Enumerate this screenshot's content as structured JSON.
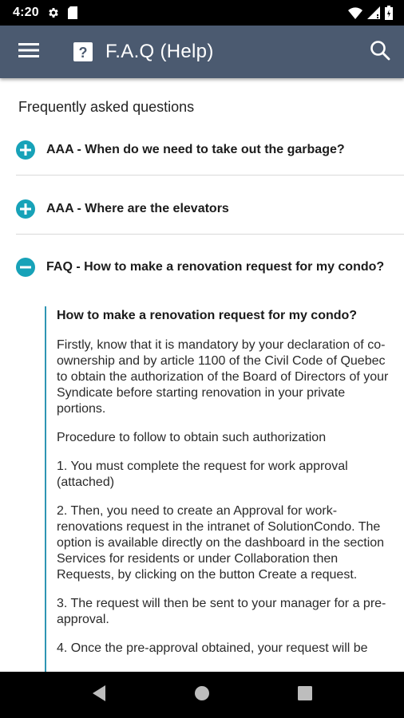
{
  "status_bar": {
    "time": "4:20"
  },
  "app_bar": {
    "title": "F.A.Q (Help)"
  },
  "faq": {
    "section_title": "Frequently asked questions",
    "items": [
      {
        "question": "AAA - When do we need to take out the garbage?",
        "expanded": false
      },
      {
        "question": "AAA - Where are the elevators",
        "expanded": false
      },
      {
        "question": "FAQ - How to make a renovation request for my condo?",
        "expanded": true
      }
    ],
    "answer": {
      "title": "How to make a renovation request for my condo?",
      "paragraphs": [
        "Firstly, know that it is mandatory by your declaration of co-ownership and by article 1100 of the Civil Code of Quebec to obtain the authorization of the Board of Directors of your Syndicate before starting renovation in your private portions.",
        "Procedure to follow to obtain such authorization",
        "1. You must complete the request for work approval (attached)",
        "2. Then, you need to create an Approval for work-renovations request in the intranet of SolutionCondo. The option is available directly on the dashboard in the section Services for residents or under Collaboration then Requests, by clicking on the button Create a request.",
        "3. The request will then be sent to your manager for a pre-approval.",
        "4. Once the pre-approval obtained, your request will be"
      ]
    }
  },
  "colors": {
    "app_bar": "#4b5a70",
    "accent": "#17a2b8",
    "answer_border": "#2f96b4"
  },
  "icons": {
    "menu": "hamburger-icon",
    "help": "question-square-icon",
    "search": "search-icon",
    "expand": "plus-circle-icon",
    "collapse": "minus-circle-icon"
  }
}
